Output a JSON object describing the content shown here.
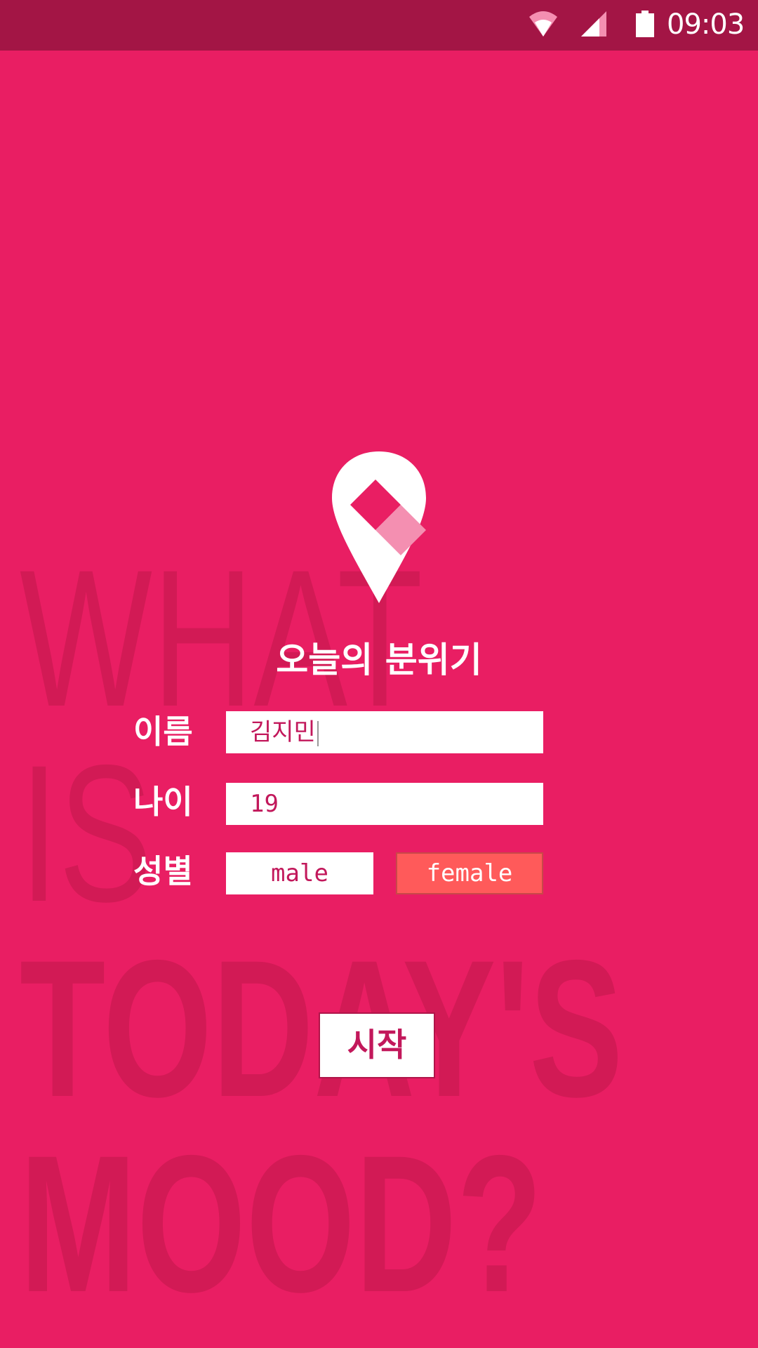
{
  "status_bar": {
    "time": "09:03",
    "icons": [
      "wifi-icon",
      "signal-icon",
      "battery-icon"
    ],
    "background_color": "#A31545"
  },
  "background_text": {
    "line1": "WHAT",
    "line2": "IS",
    "line3": "TODAY'S",
    "line4": "MOOD?"
  },
  "app": {
    "title": "오늘의 분위기",
    "logo": "map-pin-logo-icon"
  },
  "form": {
    "name_label": "이름",
    "name_value": "김지민",
    "age_label": "나이",
    "age_value": "19",
    "gender_label": "성별",
    "gender_options": [
      "male",
      "female"
    ],
    "gender_selected": "female"
  },
  "start_button": {
    "label": "시작"
  },
  "colors": {
    "background": "#E91E63",
    "accent_text": "#C2185B",
    "selected_gender": "#FF5A5A"
  }
}
